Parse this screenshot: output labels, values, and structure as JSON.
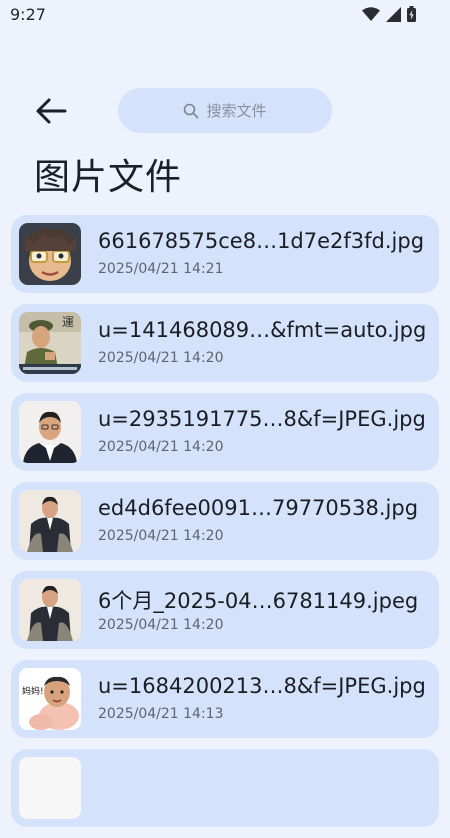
{
  "status_bar": {
    "time": "9:27"
  },
  "header": {
    "search_placeholder": "搜索文件",
    "title": "图片文件"
  },
  "files": [
    {
      "name": "661678575ce8…1d7e2f3fd.jpg",
      "date": "2025/04/21 14:21",
      "thumb": "cartoon-avatar"
    },
    {
      "name": "u=141468089…&fmt=auto.jpg",
      "date": "2025/04/21 14:20",
      "thumb": "soldier-poster"
    },
    {
      "name": "u=2935191775…8&f=JPEG.jpg",
      "date": "2025/04/21 14:20",
      "thumb": "man-portrait"
    },
    {
      "name": "ed4d6fee0091…79770538.jpg",
      "date": "2025/04/21 14:20",
      "thumb": "man-sitting"
    },
    {
      "name": "6个月_2025-04…6781149.jpeg",
      "date": "2025/04/21 14:20",
      "thumb": "man-sitting"
    },
    {
      "name": "u=1684200213…8&f=JPEG.jpg",
      "date": "2025/04/21 14:13",
      "thumb": "baby-meme"
    }
  ],
  "thumb_texts": {
    "poster_glyph": "運",
    "baby_meme": "妈妈!"
  },
  "colors": {
    "background": "#edf2fd",
    "card": "#d4e2fb",
    "title": "#1d1f26",
    "secondary_text": "#5f6470"
  }
}
